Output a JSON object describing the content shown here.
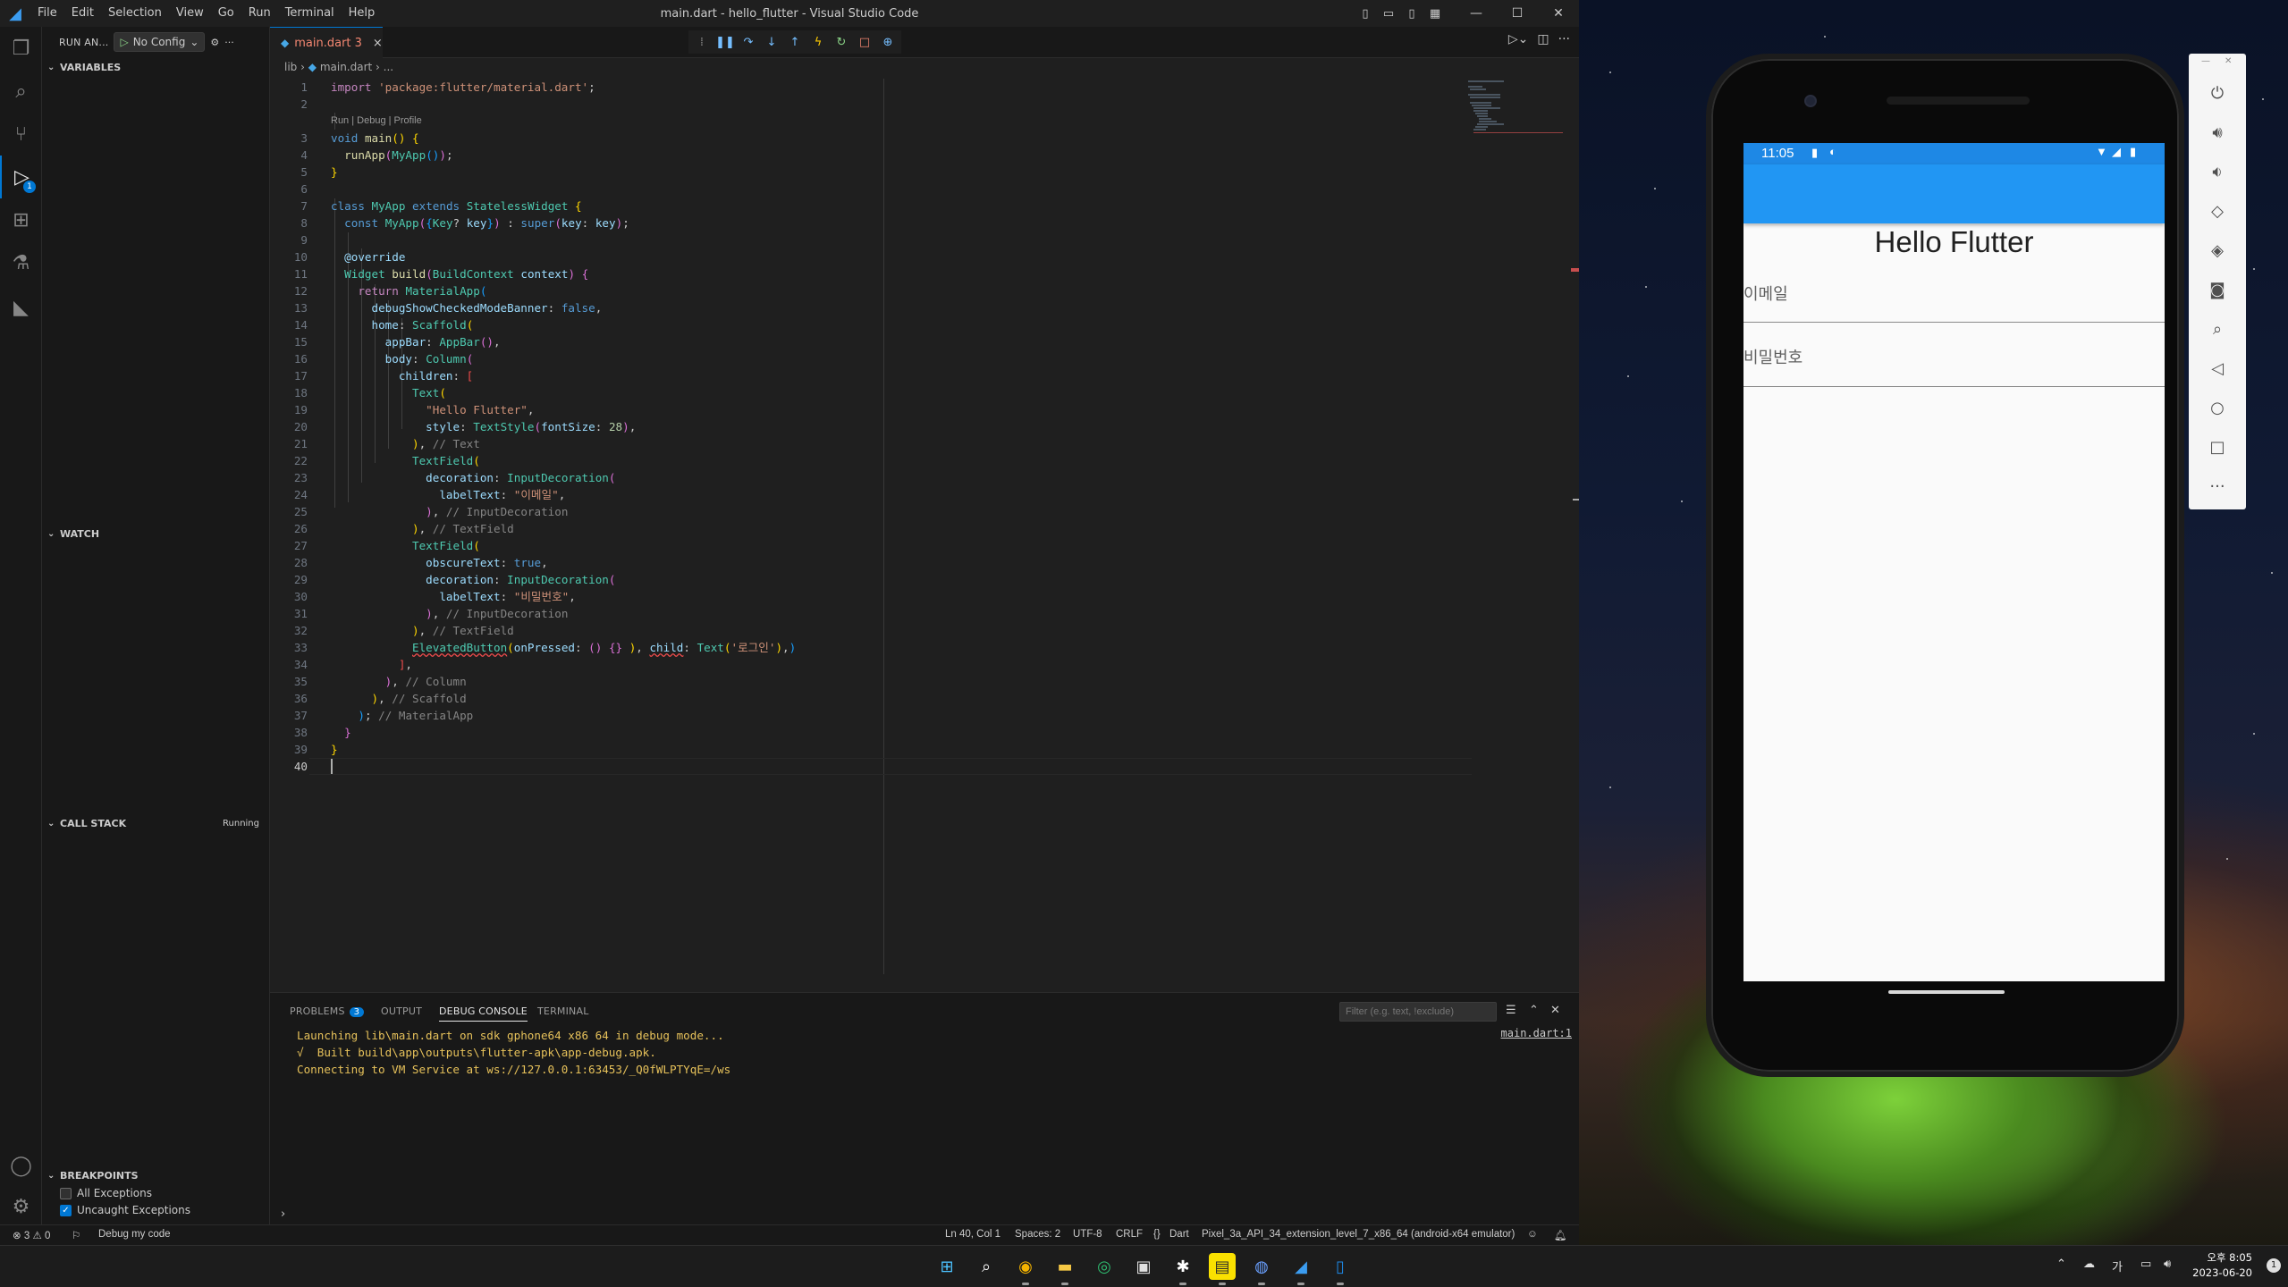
{
  "vscode": {
    "window_title": "main.dart - hello_flutter - Visual Studio Code",
    "menu": [
      "File",
      "Edit",
      "Selection",
      "View",
      "Go",
      "Run",
      "Terminal",
      "Help"
    ],
    "sidebar": {
      "run_label": "RUN AN...",
      "config_label": "No Config",
      "variables_title": "VARIABLES",
      "watch_title": "WATCH",
      "callstack_title": "CALL STACK",
      "callstack_status": "Running",
      "breakpoints_title": "BREAKPOINTS",
      "breakpoints": [
        {
          "label": "All Exceptions",
          "checked": false
        },
        {
          "label": "Uncaught Exceptions",
          "checked": true
        }
      ]
    },
    "activity_badge": "1",
    "tab": {
      "label": "main.dart 3",
      "close": "×"
    },
    "breadcrumb": {
      "folder": "lib",
      "file": "main.dart",
      "more": "..."
    },
    "codelens": "Run | Debug | Profile",
    "panel": {
      "tabs": [
        "PROBLEMS",
        "OUTPUT",
        "DEBUG CONSOLE",
        "TERMINAL"
      ],
      "problems_count": "3",
      "filter_placeholder": "Filter (e.g. text, !exclude)",
      "source_link": "main.dart:1",
      "console_lines": [
        "Launching lib\\main.dart on sdk gphone64 x86 64 in debug mode...",
        "√  Built build\\app\\outputs\\flutter-apk\\app-debug.apk.",
        "Connecting to VM Service at ws://127.0.0.1:63453/_Q0fWLPTYqE=/ws"
      ]
    },
    "statusbar": {
      "errors": "3",
      "warnings": "0",
      "debug_label": "Debug my code",
      "position": "Ln 40, Col 1",
      "spaces": "Spaces: 2",
      "encoding": "UTF-8",
      "eol": "CRLF",
      "language": "Dart",
      "device": "Pixel_3a_API_34_extension_level_7_x86_64 (android-x64 emulator)"
    }
  },
  "emulator": {
    "time": "11:05",
    "hello_text": "Hello Flutter",
    "email_label": "이메일",
    "password_label": "비밀번호",
    "appbar_color": "#2196f3"
  },
  "taskbar": {
    "ime": "가",
    "time": "오후 8:05",
    "date": "2023-06-20",
    "notification_count": "1"
  }
}
